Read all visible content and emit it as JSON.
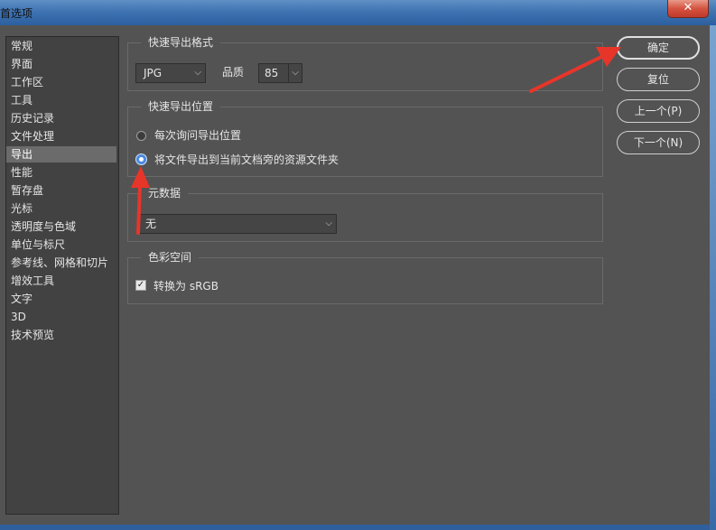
{
  "window": {
    "title": "首选项",
    "close_glyph": "✕"
  },
  "sidebar": {
    "items": [
      {
        "label": "常规"
      },
      {
        "label": "界面"
      },
      {
        "label": "工作区"
      },
      {
        "label": "工具"
      },
      {
        "label": "历史记录"
      },
      {
        "label": "文件处理"
      },
      {
        "label": "导出"
      },
      {
        "label": "性能"
      },
      {
        "label": "暂存盘"
      },
      {
        "label": "光标"
      },
      {
        "label": "透明度与色域"
      },
      {
        "label": "单位与标尺"
      },
      {
        "label": "参考线、网格和切片"
      },
      {
        "label": "增效工具"
      },
      {
        "label": "文字"
      },
      {
        "label": "3D"
      },
      {
        "label": "技术预览"
      }
    ],
    "selected": "导出"
  },
  "quick_export_format": {
    "legend": "快速导出格式",
    "format_value": "JPG",
    "quality_label": "品质",
    "quality_value": "85"
  },
  "quick_export_location": {
    "legend": "快速导出位置",
    "option_ask": "每次询问导出位置",
    "option_assets": "将文件导出到当前文档旁的资源文件夹",
    "selected": "option_assets"
  },
  "metadata": {
    "legend": "元数据",
    "value": "无"
  },
  "color_space": {
    "legend": "色彩空间",
    "convert_label": "转换为 sRGB",
    "checked": true,
    "check_glyph": "✓"
  },
  "buttons": {
    "ok": "确定",
    "reset": "复位",
    "prev": "上一个(P)",
    "next": "下一个(N)"
  },
  "icons": {
    "chevron": "⌵"
  },
  "colors": {
    "annotation": "#e8352a",
    "radio_accent": "#4a8be2",
    "panel": "#535353"
  }
}
